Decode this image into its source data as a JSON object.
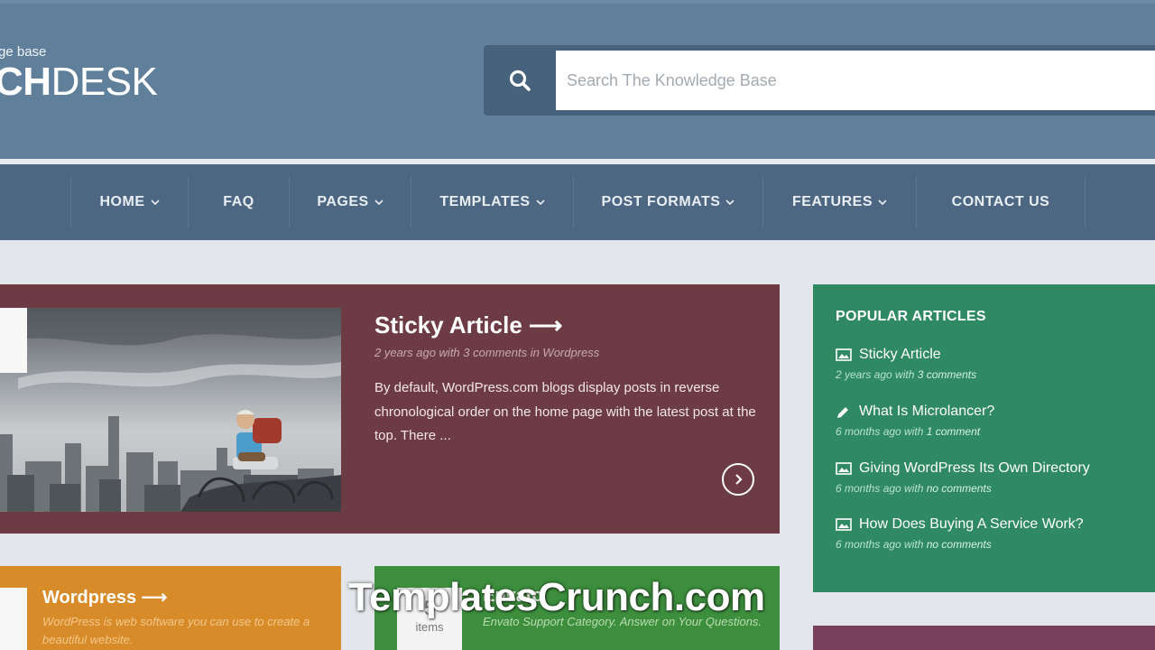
{
  "header": {
    "tagline": "ge base",
    "logo_bold": "CH",
    "logo_light": "DESK",
    "search": {
      "placeholder": "Search The Knowledge Base",
      "icon": "search-icon"
    }
  },
  "nav": {
    "items": [
      {
        "label": "HOME",
        "dropdown": true
      },
      {
        "label": "FAQ",
        "dropdown": false
      },
      {
        "label": "PAGES",
        "dropdown": true
      },
      {
        "label": "TEMPLATES",
        "dropdown": true
      },
      {
        "label": "POST FORMATS",
        "dropdown": true
      },
      {
        "label": "FEATURES",
        "dropdown": true
      },
      {
        "label": "CONTACT US",
        "dropdown": false
      }
    ]
  },
  "sticky": {
    "title": "Sticky Article ⟶",
    "meta": "2 years ago with 3 comments in Wordpress",
    "excerpt": "By default, WordPress.com blogs display posts in reverse chronological order on the home page with the latest post at the top. There ...",
    "tag_glyph": "r"
  },
  "popular": {
    "title": "POPULAR ARTICLES",
    "items": [
      {
        "icon": "image-icon",
        "title": "Sticky Article",
        "meta_prefix": "2 years ago with ",
        "meta_em": "3 comments"
      },
      {
        "icon": "pencil-icon",
        "title": "What Is Microlancer?",
        "meta_prefix": "6 months ago with ",
        "meta_em": "1 comment"
      },
      {
        "icon": "image-icon",
        "title": "Giving WordPress Its Own Directory",
        "meta_prefix": "6 months ago with ",
        "meta_em": "no comments"
      },
      {
        "icon": "image-icon",
        "title": "How Does Buying A Service Work?",
        "meta_prefix": "6 months ago with ",
        "meta_em": "no comments"
      }
    ]
  },
  "wordpress_card": {
    "title": "Wordpress ⟶",
    "desc": "WordPress is web software you can use to create a beautiful website.",
    "count_glyph": "s"
  },
  "envato_card": {
    "title": "Envato",
    "desc": "Envato Support Category. Answer on Your Questions.",
    "count": "5",
    "count_label": "items"
  },
  "watermark": "TemplatesCrunch.com",
  "colors": {
    "header": "#5f7f9b",
    "nav": "#4d6782",
    "sticky": "#6d3b44",
    "popular": "#2f8a64",
    "wordpress": "#d88b29",
    "envato": "#3d8f3e"
  }
}
